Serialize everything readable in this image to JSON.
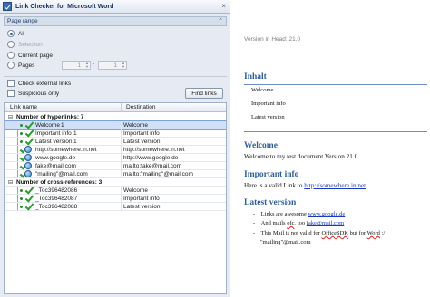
{
  "window": {
    "title": "Link Checker for Microsoft Word",
    "close": "×"
  },
  "page_range": {
    "header": "Page range",
    "options": [
      "All",
      "Selection",
      "Current page",
      "Pages"
    ],
    "from_value": "1",
    "to_value": "1",
    "dash": "-"
  },
  "options": {
    "check_external": "Check external links",
    "suspicious_only": "Suspicious only",
    "find_button": "Find links"
  },
  "grid": {
    "col_link": "Link name",
    "col_dest": "Destination",
    "hyperlinks_group": "Number of hyperlinks: 7",
    "hyperlinks": [
      {
        "name": "Welcome",
        "num": "1",
        "dest": "Welcome"
      },
      {
        "name": "Important info",
        "num": "1",
        "dest": "Important info"
      },
      {
        "name": "Latest version",
        "num": "1",
        "dest": "Latest version"
      },
      {
        "name": "http://somewhere.in.net",
        "num": "",
        "dest": "http://somewhere.in.net"
      },
      {
        "name": "www.google.de",
        "num": "",
        "dest": "http://www.google.de"
      },
      {
        "name": "fake@mail.com",
        "num": "",
        "dest": "mailto:fake@mail.com"
      },
      {
        "name": "\"mailing\"@mail.com",
        "num": "",
        "dest": "mailto:\"mailing\"@mail.com"
      }
    ],
    "xref_group": "Number of cross-references: 3",
    "xrefs": [
      {
        "name": "_Toc396482086",
        "dest": "Welcome"
      },
      {
        "name": "_Toc396482087",
        "dest": "Important info"
      },
      {
        "name": "_Toc396482088",
        "dest": "Latest version"
      }
    ]
  },
  "document": {
    "version_head": "Version in Head: 21.0",
    "inhalt": "Inhalt",
    "toc": [
      "Welcome",
      "Important info",
      "Latest version"
    ],
    "welcome_h": "Welcome",
    "welcome_p": "Welcome to my test document Version 21.0.",
    "important_h": "Important info",
    "important_p_pre": "Here is a valid Link to ",
    "important_link": "http://somewhere.in.net",
    "latest_h": "Latest version",
    "b1_pre": "Links are awesome ",
    "b1_link": "www.google.de",
    "b2_pre": "And mails ",
    "b2_sq": "ofc",
    "b2_mid": ", too ",
    "b2_link": "fake@mail.com",
    "b3_pre": "This Mail is not valid for ",
    "b3_sq": "OfficeSDK",
    "b3_mid": " but for ",
    "b3_word": "Word",
    "b3_end": " :/",
    "b3_line2": "\"mailing\"@mail.com",
    "bullet_char": "-"
  },
  "colors": {
    "heading": "#2e5d9a",
    "link": "#1a38c0",
    "check": "#2e9b2e",
    "selection": "#cfe0f8"
  }
}
